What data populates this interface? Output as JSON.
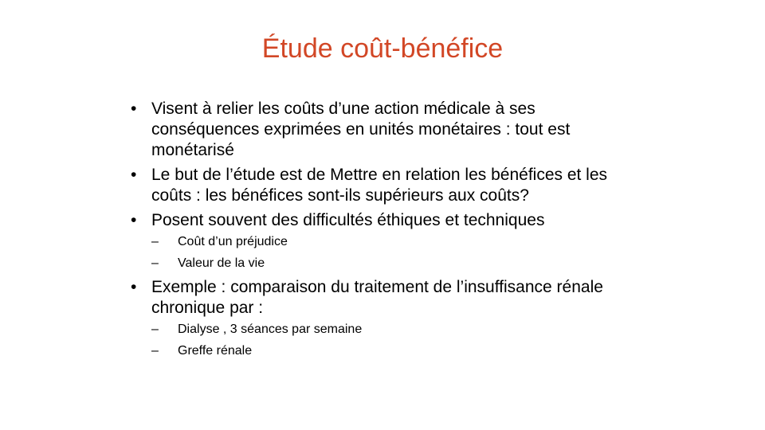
{
  "title": "Étude coût-bénéfice",
  "bullet_glyph": "•",
  "dash_glyph": "–",
  "accent_color": "#d24726",
  "items": [
    {
      "text": "Visent à relier les coûts d’une action médicale à ses conséquences exprimées en unités monétaires : tout est monétarisé",
      "sub": []
    },
    {
      "text": "Le but  de l’étude est de Mettre en relation les bénéfices et les coûts : les bénéfices sont-ils supérieurs aux coûts?",
      "sub": []
    },
    {
      "text": "Posent souvent des difficultés éthiques et techniques",
      "sub": [
        "Coût d’un  préjudice",
        "Valeur de la vie"
      ]
    },
    {
      "text": "Exemple : comparaison du  traitement de l’insuffisance rénale chronique par :",
      "sub": [
        "Dialyse , 3 séances par semaine",
        "Greffe rénale"
      ]
    }
  ]
}
